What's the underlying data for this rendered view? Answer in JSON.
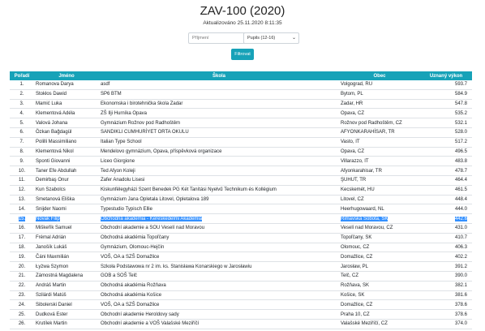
{
  "header": {
    "title": "ZAV-100 (2020)",
    "updated": "Aktualizováno 25.11.2020 8:11:35"
  },
  "filters": {
    "name_placeholder": "Příjmení",
    "category_value": "Pupils (12-16)",
    "button_label": "Filtrovat"
  },
  "table": {
    "columns": [
      "Pořadí",
      "Jméno",
      "Škola",
      "Obec",
      "Uznaný výkon"
    ],
    "highlighted_row": 14,
    "rows": [
      [
        "1.",
        "Romanova Darya",
        "asdf",
        "Volgograd, RU",
        "593.7"
      ],
      [
        "2.",
        "Stokłos Dawid",
        "SP6 BTM",
        "Bytom, PL",
        "584.9"
      ],
      [
        "3.",
        "Mamić Luka",
        "Ekonomska i birotehnička škola Zadar",
        "Zadar, HR",
        "547.8"
      ],
      [
        "4.",
        "Klementová Adéla",
        "ZŠ Ilji Hurníka Opava",
        "Opava, CZ",
        "535.2"
      ],
      [
        "5.",
        "Valová Johana",
        "Gymnázium Rožnov pod Radhoštěm",
        "Rožnov pod Radhoštěm, CZ",
        "532.1"
      ],
      [
        "6.",
        "Özkan Bağdagül",
        "SANDIKLI CUMHURİYET ORTA OKULU",
        "AFYONKARAHİSAR, TR",
        "528.0"
      ],
      [
        "7.",
        "Polilli Massimiliano",
        "Italian Type School",
        "Vasto, IT",
        "517.2"
      ],
      [
        "8.",
        "Klementová Nikol",
        "Mendelovo gymnázium, Opava, příspěvková organizace",
        "Opava, CZ",
        "496.5"
      ],
      [
        "9.",
        "Sponti Giovanni",
        "Liceo Giorgione",
        "Villarazzo, IT",
        "483.8"
      ],
      [
        "10.",
        "Taner Efe Abdullah",
        "Ted Afyon Koleji",
        "Afyonkarahisar, TR",
        "478.7"
      ],
      [
        "11.",
        "Demirbaş Onur",
        "Zafer Anadolu Lisesi",
        "ŞUHUT, TR",
        "464.4"
      ],
      [
        "12.",
        "Kun Szabolcs",
        "Kiskunfélegyházi Szent Benedek PG Két Tanítási Nyelvű Technikum és Kollégium",
        "Kecskemét, HU",
        "461.5"
      ],
      [
        "13.",
        "Smetanová Eliška",
        "Gymnázium Jana Opletala Litovel, Opletalova 189",
        "Litovel, CZ",
        "448.4"
      ],
      [
        "14.",
        "Snijder Naomi",
        "Typestudio Typisch Ellie",
        "Heerhugowaard, NL",
        "444.0"
      ],
      [
        "15.",
        "Novák Filip",
        "Obchodná akadémia - Kereskedelmi Akadémia",
        "Rimavská Sobota, SK",
        "442.6"
      ],
      [
        "16.",
        "Miškeřík Samuel",
        "Obchodní akademie a SOU Veselí nad Moravou",
        "Veselí nad Moravou, CZ",
        "431.0"
      ],
      [
        "17.",
        "Frémal Adrián",
        "Obchodná akadémia Topoľčany",
        "Topoľčany, SK",
        "410.7"
      ],
      [
        "18.",
        "Janošík Lukáš",
        "Gymnázium, Olomouc-Hejčín",
        "Olomouc, CZ",
        "406.3"
      ],
      [
        "19.",
        "Čáni Maxmilián",
        "VOŠ, OA a SZŠ Domažlice",
        "Domažlice, CZ",
        "402.2"
      ],
      [
        "20.",
        "Łyżwa Szymon",
        "Szkoła Podstawowa nr 2 im. ks. Stanisława Konarskiego w Jarosławiu",
        "Jarosław, PL",
        "391.2"
      ],
      [
        "21.",
        "Zámostná Magdalena",
        "GOB a SOŠ Telč",
        "Telč, CZ",
        "390.0"
      ],
      [
        "22.",
        "Andráš Martin",
        "Obchodná akadémia Rožňava",
        "Rožňava, SK",
        "382.1"
      ],
      [
        "23.",
        "Szilárdi Matúš",
        "Obchodná akadémia Košice",
        "Košice, SK",
        "381.6"
      ],
      [
        "24.",
        "Sibolerski Daniel",
        "VOŠ, OA a SZŠ Domažlice",
        "Domažlice, CZ",
        "378.6"
      ],
      [
        "25.",
        "Dudková Ester",
        "Obchodní akademie Heroldovy sady",
        "Praha 10, CZ",
        "378.6"
      ],
      [
        "26.",
        "Krutílek Martin",
        "Obchodní akademie a VOŠ Valašské Meziříčí",
        "Valašské Meziříčí, CZ",
        "374.0"
      ]
    ]
  }
}
